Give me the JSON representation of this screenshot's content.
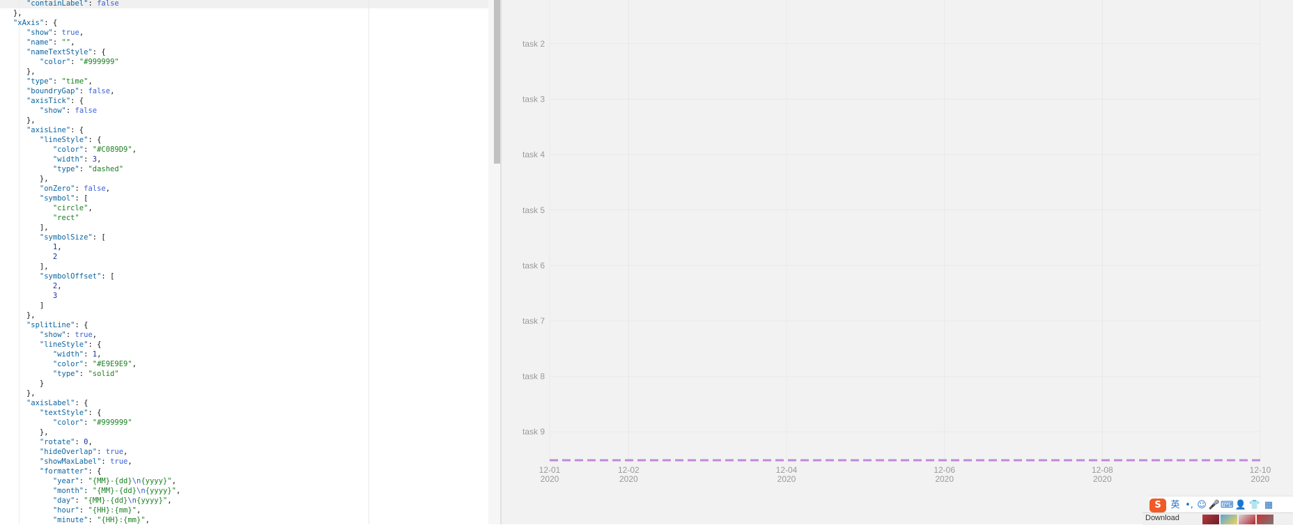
{
  "editor": {
    "lines": [
      [
        [
          6,
          "\"containLabel\"",
          "key"
        ],
        [
          0,
          ": ",
          "p"
        ],
        [
          0,
          "false",
          "kw"
        ]
      ],
      [
        [
          3,
          "},",
          "p"
        ]
      ],
      [
        [
          3,
          "\"xAxis\"",
          "key"
        ],
        [
          0,
          ": {",
          "p"
        ]
      ],
      [
        [
          6,
          "\"show\"",
          "key"
        ],
        [
          0,
          ": ",
          "p"
        ],
        [
          0,
          "true",
          "kw"
        ],
        [
          0,
          ",",
          "p"
        ]
      ],
      [
        [
          6,
          "\"name\"",
          "key"
        ],
        [
          0,
          ": ",
          "p"
        ],
        [
          0,
          "\"\"",
          "str"
        ],
        [
          0,
          ",",
          "p"
        ]
      ],
      [
        [
          6,
          "\"nameTextStyle\"",
          "key"
        ],
        [
          0,
          ": {",
          "p"
        ]
      ],
      [
        [
          9,
          "\"color\"",
          "key"
        ],
        [
          0,
          ": ",
          "p"
        ],
        [
          0,
          "\"#999999\"",
          "str"
        ]
      ],
      [
        [
          6,
          "},",
          "p"
        ]
      ],
      [
        [
          6,
          "\"type\"",
          "key"
        ],
        [
          0,
          ": ",
          "p"
        ],
        [
          0,
          "\"time\"",
          "str"
        ],
        [
          0,
          ",",
          "p"
        ]
      ],
      [
        [
          6,
          "\"boundryGap\"",
          "key"
        ],
        [
          0,
          ": ",
          "p"
        ],
        [
          0,
          "false",
          "kw"
        ],
        [
          0,
          ",",
          "p"
        ]
      ],
      [
        [
          6,
          "\"axisTick\"",
          "key"
        ],
        [
          0,
          ": {",
          "p"
        ]
      ],
      [
        [
          9,
          "\"show\"",
          "key"
        ],
        [
          0,
          ": ",
          "p"
        ],
        [
          0,
          "false",
          "kw"
        ]
      ],
      [
        [
          6,
          "},",
          "p"
        ]
      ],
      [
        [
          6,
          "\"axisLine\"",
          "key"
        ],
        [
          0,
          ": {",
          "p"
        ]
      ],
      [
        [
          9,
          "\"lineStyle\"",
          "key"
        ],
        [
          0,
          ": {",
          "p"
        ]
      ],
      [
        [
          12,
          "\"color\"",
          "key"
        ],
        [
          0,
          ": ",
          "p"
        ],
        [
          0,
          "\"#C089D9\"",
          "str"
        ],
        [
          0,
          ",",
          "p"
        ]
      ],
      [
        [
          12,
          "\"width\"",
          "key"
        ],
        [
          0,
          ": ",
          "p"
        ],
        [
          0,
          "3",
          "num"
        ],
        [
          0,
          ",",
          "p"
        ]
      ],
      [
        [
          12,
          "\"type\"",
          "key"
        ],
        [
          0,
          ": ",
          "p"
        ],
        [
          0,
          "\"dashed\"",
          "str"
        ]
      ],
      [
        [
          9,
          "},",
          "p"
        ]
      ],
      [
        [
          9,
          "\"onZero\"",
          "key"
        ],
        [
          0,
          ": ",
          "p"
        ],
        [
          0,
          "false",
          "kw"
        ],
        [
          0,
          ",",
          "p"
        ]
      ],
      [
        [
          9,
          "\"symbol\"",
          "key"
        ],
        [
          0,
          ": [",
          "p"
        ]
      ],
      [
        [
          12,
          "\"circle\"",
          "str"
        ],
        [
          0,
          ",",
          "p"
        ]
      ],
      [
        [
          12,
          "\"rect\"",
          "str"
        ]
      ],
      [
        [
          9,
          "],",
          "p"
        ]
      ],
      [
        [
          9,
          "\"symbolSize\"",
          "key"
        ],
        [
          0,
          ": [",
          "p"
        ]
      ],
      [
        [
          12,
          "1",
          "num"
        ],
        [
          0,
          ",",
          "p"
        ]
      ],
      [
        [
          12,
          "2",
          "num"
        ]
      ],
      [
        [
          9,
          "],",
          "p"
        ]
      ],
      [
        [
          9,
          "\"symbolOffset\"",
          "key"
        ],
        [
          0,
          ": [",
          "p"
        ]
      ],
      [
        [
          12,
          "2",
          "num"
        ],
        [
          0,
          ",",
          "p"
        ]
      ],
      [
        [
          12,
          "3",
          "num"
        ]
      ],
      [
        [
          9,
          "]",
          "p"
        ]
      ],
      [
        [
          6,
          "},",
          "p"
        ]
      ],
      [
        [
          6,
          "\"splitLine\"",
          "key"
        ],
        [
          0,
          ": {",
          "p"
        ]
      ],
      [
        [
          9,
          "\"show\"",
          "key"
        ],
        [
          0,
          ": ",
          "p"
        ],
        [
          0,
          "true",
          "kw"
        ],
        [
          0,
          ",",
          "p"
        ]
      ],
      [
        [
          9,
          "\"lineStyle\"",
          "key"
        ],
        [
          0,
          ": {",
          "p"
        ]
      ],
      [
        [
          12,
          "\"width\"",
          "key"
        ],
        [
          0,
          ": ",
          "p"
        ],
        [
          0,
          "1",
          "num"
        ],
        [
          0,
          ",",
          "p"
        ]
      ],
      [
        [
          12,
          "\"color\"",
          "key"
        ],
        [
          0,
          ": ",
          "p"
        ],
        [
          0,
          "\"#E9E9E9\"",
          "str"
        ],
        [
          0,
          ",",
          "p"
        ]
      ],
      [
        [
          12,
          "\"type\"",
          "key"
        ],
        [
          0,
          ": ",
          "p"
        ],
        [
          0,
          "\"solid\"",
          "str"
        ]
      ],
      [
        [
          9,
          "}",
          "p"
        ]
      ],
      [
        [
          6,
          "},",
          "p"
        ]
      ],
      [
        [
          6,
          "\"axisLabel\"",
          "key"
        ],
        [
          0,
          ": {",
          "p"
        ]
      ],
      [
        [
          9,
          "\"textStyle\"",
          "key"
        ],
        [
          0,
          ": {",
          "p"
        ]
      ],
      [
        [
          12,
          "\"color\"",
          "key"
        ],
        [
          0,
          ": ",
          "p"
        ],
        [
          0,
          "\"#999999\"",
          "str"
        ]
      ],
      [
        [
          9,
          "},",
          "p"
        ]
      ],
      [
        [
          9,
          "\"rotate\"",
          "key"
        ],
        [
          0,
          ": ",
          "p"
        ],
        [
          0,
          "0",
          "num"
        ],
        [
          0,
          ",",
          "p"
        ]
      ],
      [
        [
          9,
          "\"hideOverlap\"",
          "key"
        ],
        [
          0,
          ": ",
          "p"
        ],
        [
          0,
          "true",
          "kw"
        ],
        [
          0,
          ",",
          "p"
        ]
      ],
      [
        [
          9,
          "\"showMaxLabel\"",
          "key"
        ],
        [
          0,
          ": ",
          "p"
        ],
        [
          0,
          "true",
          "kw"
        ],
        [
          0,
          ",",
          "p"
        ]
      ],
      [
        [
          9,
          "\"formatter\"",
          "key"
        ],
        [
          0,
          ": {",
          "p"
        ]
      ],
      [
        [
          12,
          "\"year\"",
          "key"
        ],
        [
          0,
          ": ",
          "p"
        ],
        [
          0,
          "\"{MM}-{dd}",
          "str"
        ],
        [
          0,
          "\\n",
          "esc"
        ],
        [
          0,
          "{yyyy}\"",
          "str"
        ],
        [
          0,
          ",",
          "p"
        ]
      ],
      [
        [
          12,
          "\"month\"",
          "key"
        ],
        [
          0,
          ": ",
          "p"
        ],
        [
          0,
          "\"{MM}-{dd}",
          "str"
        ],
        [
          0,
          "\\n",
          "esc"
        ],
        [
          0,
          "{yyyy}\"",
          "str"
        ],
        [
          0,
          ",",
          "p"
        ]
      ],
      [
        [
          12,
          "\"day\"",
          "key"
        ],
        [
          0,
          ": ",
          "p"
        ],
        [
          0,
          "\"{MM}-{dd}",
          "str"
        ],
        [
          0,
          "\\n",
          "esc"
        ],
        [
          0,
          "{yyyy}\"",
          "str"
        ],
        [
          0,
          ",",
          "p"
        ]
      ],
      [
        [
          12,
          "\"hour\"",
          "key"
        ],
        [
          0,
          ": ",
          "p"
        ],
        [
          0,
          "\"{HH}:{mm}\"",
          "str"
        ],
        [
          0,
          ",",
          "p"
        ]
      ],
      [
        [
          12,
          "\"minute\"",
          "key"
        ],
        [
          0,
          ": ",
          "p"
        ],
        [
          0,
          "\"{HH}:{mm}\"",
          "str"
        ],
        [
          0,
          ",",
          "p"
        ]
      ]
    ]
  },
  "chart_data": {
    "type": "bar",
    "categories": [
      "task 2",
      "task 3",
      "task 4",
      "task 5",
      "task 6",
      "task 7",
      "task 8",
      "task 9"
    ],
    "x_ticks": [
      {
        "date": "2020-12-01",
        "label_top": "12-01",
        "label_bottom": "2020"
      },
      {
        "date": "2020-12-02",
        "label_top": "12-02",
        "label_bottom": "2020"
      },
      {
        "date": "2020-12-04",
        "label_top": "12-04",
        "label_bottom": "2020"
      },
      {
        "date": "2020-12-06",
        "label_top": "12-06",
        "label_bottom": "2020"
      },
      {
        "date": "2020-12-08",
        "label_top": "12-08",
        "label_bottom": "2020"
      },
      {
        "date": "2020-12-10",
        "label_top": "12-10",
        "label_bottom": "2020"
      }
    ],
    "xlim": [
      "2020-12-01",
      "2020-12-10"
    ],
    "series": [],
    "grid": true,
    "axis_line_color": "#C089D9",
    "axis_label_color": "#999999",
    "split_line_color": "#E9E9E9",
    "background": "#F2F2F2"
  },
  "tray": {
    "ime_items": [
      {
        "icon": "sogou-s-icon",
        "glyph": "S"
      },
      {
        "icon": "ime-english-mode-icon",
        "glyph": "英"
      },
      {
        "icon": "punctuation-icon",
        "glyph": "•,"
      },
      {
        "icon": "emoji-icon",
        "glyph": "☺"
      },
      {
        "icon": "microphone-icon",
        "glyph": "🎤"
      },
      {
        "icon": "keyboard-icon",
        "glyph": "⌨"
      },
      {
        "icon": "user-icon",
        "glyph": "👤"
      },
      {
        "icon": "skin-shirt-icon",
        "glyph": "👕"
      },
      {
        "icon": "toolbox-icon",
        "glyph": "▦"
      }
    ],
    "download_label": "Download"
  }
}
